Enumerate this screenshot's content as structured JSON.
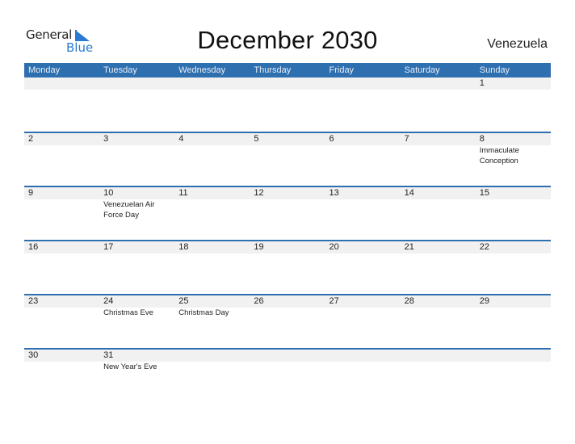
{
  "logo": {
    "line1": "General",
    "line2": "Blue",
    "icon": "flag-triangle-icon",
    "brand_color": "#2a7ad1"
  },
  "header": {
    "title": "December 2030",
    "country": "Venezuela"
  },
  "colors": {
    "header_bg": "#2e6fb0",
    "row_border": "#2e6fb0",
    "date_strip": "#f1f1f1"
  },
  "calendar": {
    "weekdays": [
      "Monday",
      "Tuesday",
      "Wednesday",
      "Thursday",
      "Friday",
      "Saturday",
      "Sunday"
    ],
    "weeks": [
      [
        {
          "day": "",
          "holiday": ""
        },
        {
          "day": "",
          "holiday": ""
        },
        {
          "day": "",
          "holiday": ""
        },
        {
          "day": "",
          "holiday": ""
        },
        {
          "day": "",
          "holiday": ""
        },
        {
          "day": "",
          "holiday": ""
        },
        {
          "day": "1",
          "holiday": ""
        }
      ],
      [
        {
          "day": "2",
          "holiday": ""
        },
        {
          "day": "3",
          "holiday": ""
        },
        {
          "day": "4",
          "holiday": ""
        },
        {
          "day": "5",
          "holiday": ""
        },
        {
          "day": "6",
          "holiday": ""
        },
        {
          "day": "7",
          "holiday": ""
        },
        {
          "day": "8",
          "holiday": "Immaculate Conception"
        }
      ],
      [
        {
          "day": "9",
          "holiday": ""
        },
        {
          "day": "10",
          "holiday": "Venezuelan Air Force Day"
        },
        {
          "day": "11",
          "holiday": ""
        },
        {
          "day": "12",
          "holiday": ""
        },
        {
          "day": "13",
          "holiday": ""
        },
        {
          "day": "14",
          "holiday": ""
        },
        {
          "day": "15",
          "holiday": ""
        }
      ],
      [
        {
          "day": "16",
          "holiday": ""
        },
        {
          "day": "17",
          "holiday": ""
        },
        {
          "day": "18",
          "holiday": ""
        },
        {
          "day": "19",
          "holiday": ""
        },
        {
          "day": "20",
          "holiday": ""
        },
        {
          "day": "21",
          "holiday": ""
        },
        {
          "day": "22",
          "holiday": ""
        }
      ],
      [
        {
          "day": "23",
          "holiday": ""
        },
        {
          "day": "24",
          "holiday": "Christmas Eve"
        },
        {
          "day": "25",
          "holiday": "Christmas Day"
        },
        {
          "day": "26",
          "holiday": ""
        },
        {
          "day": "27",
          "holiday": ""
        },
        {
          "day": "28",
          "holiday": ""
        },
        {
          "day": "29",
          "holiday": ""
        }
      ],
      [
        {
          "day": "30",
          "holiday": ""
        },
        {
          "day": "31",
          "holiday": "New Year's Eve"
        },
        {
          "day": "",
          "holiday": ""
        },
        {
          "day": "",
          "holiday": ""
        },
        {
          "day": "",
          "holiday": ""
        },
        {
          "day": "",
          "holiday": ""
        },
        {
          "day": "",
          "holiday": ""
        }
      ]
    ]
  }
}
